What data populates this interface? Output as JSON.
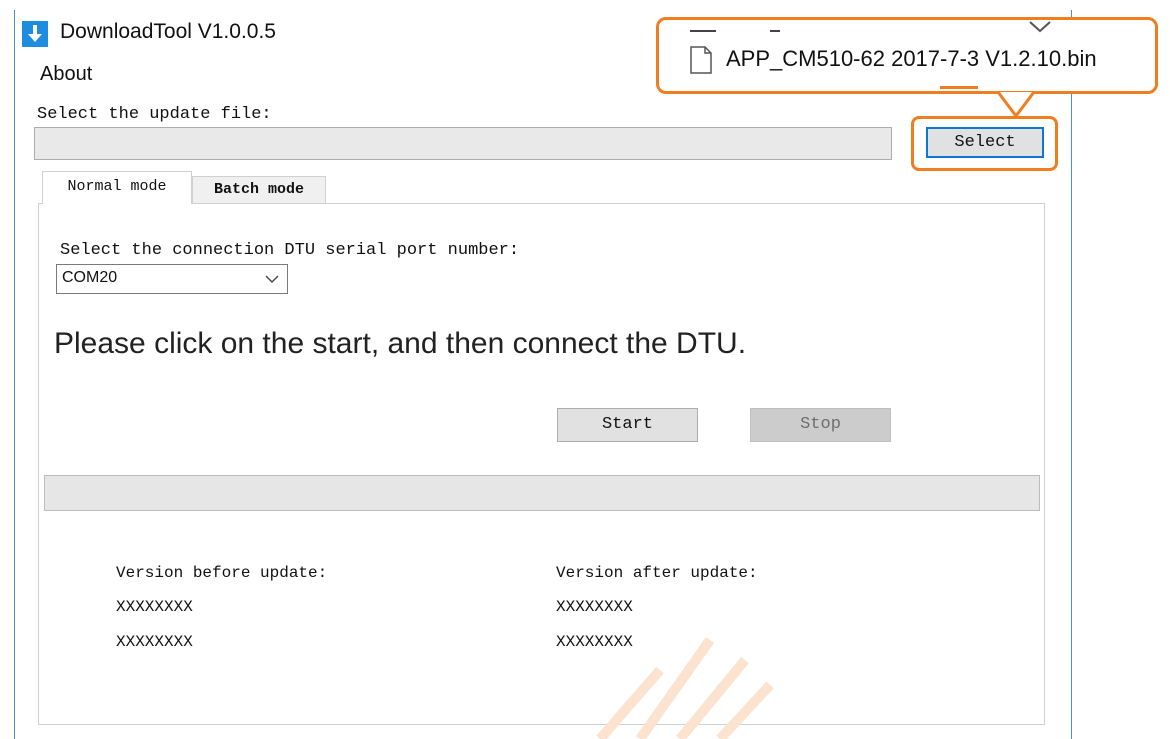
{
  "window": {
    "title": "DownloadTool V1.0.0.5",
    "menu_about": "About"
  },
  "file": {
    "label": "Select the update file:",
    "path_value": "",
    "select_label": "Select"
  },
  "callout": {
    "filename": "APP_CM510-62 2017-7-3 V1.2.10.bin"
  },
  "tabs": [
    {
      "label": "Normal mode",
      "active": true
    },
    {
      "label": "Batch mode",
      "active": false
    }
  ],
  "port": {
    "label": "Select the connection DTU serial port number:",
    "value": "COM20"
  },
  "instruction": "Please click on the start, and then connect the DTU.",
  "buttons": {
    "start": "Start",
    "stop": "Stop"
  },
  "progress": {
    "fraction": 0
  },
  "versions": {
    "before_label": "Version before update:",
    "before_line1": "XXXXXXXX",
    "before_line2": "XXXXXXXX",
    "after_label": "Version after update:",
    "after_line1": "XXXXXXXX",
    "after_line2": "XXXXXXXX"
  },
  "colors": {
    "highlight": "#f07d1f",
    "focus_border": "#0b78d7",
    "icon_blue": "#1e8de0"
  },
  "icons": {
    "app": "download-arrow-icon",
    "file": "document-icon",
    "dropdown": "chevron-down-icon"
  }
}
